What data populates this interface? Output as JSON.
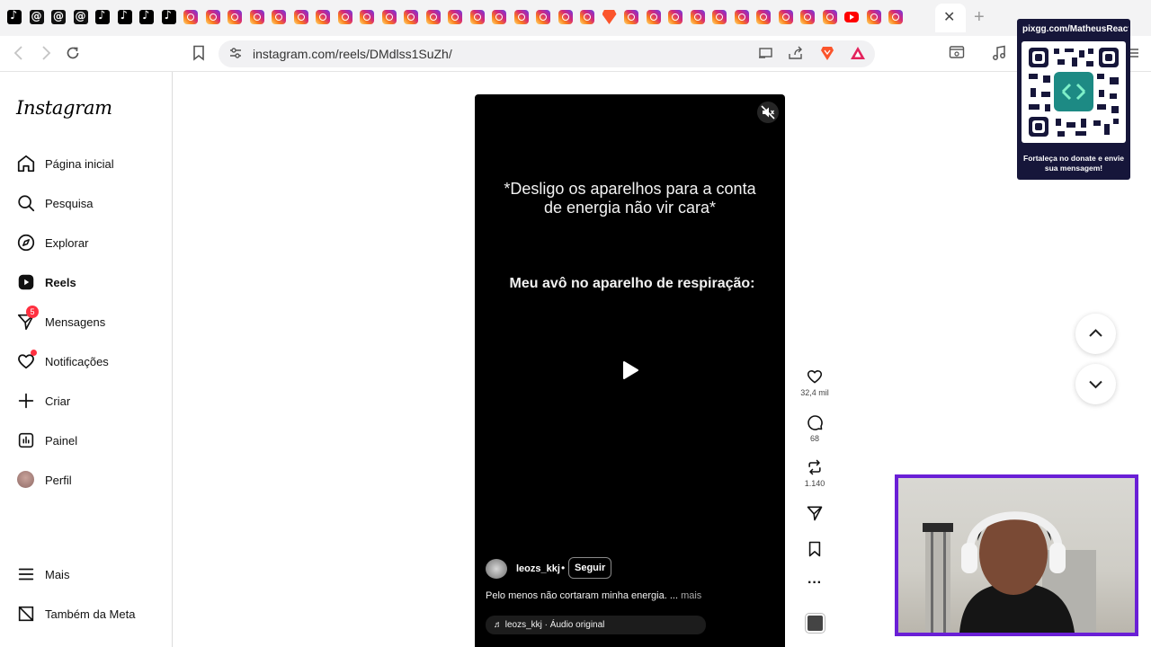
{
  "browser": {
    "tabs": [
      "tiktok",
      "threads",
      "threads",
      "threads",
      "tiktok",
      "tiktok",
      "tiktok",
      "tiktok",
      "insta",
      "insta",
      "insta",
      "insta",
      "insta",
      "insta",
      "insta",
      "insta",
      "insta",
      "insta",
      "insta",
      "insta",
      "insta",
      "insta",
      "insta",
      "insta",
      "insta",
      "insta",
      "insta",
      "brave",
      "insta",
      "insta",
      "insta",
      "insta",
      "insta",
      "insta",
      "insta",
      "insta",
      "insta",
      "insta",
      "youtube",
      "insta",
      "insta"
    ],
    "url": "instagram.com/reels/DMdlss1SuZh/",
    "close_glyph": "✕",
    "new_tab_glyph": "+"
  },
  "sidebar": {
    "logo": "Instagram",
    "items": [
      {
        "label": "Página inicial",
        "icon": "home-icon"
      },
      {
        "label": "Pesquisa",
        "icon": "search-icon"
      },
      {
        "label": "Explorar",
        "icon": "compass-icon"
      },
      {
        "label": "Reels",
        "icon": "reels-icon",
        "active": true
      },
      {
        "label": "Mensagens",
        "icon": "messenger-icon",
        "badge": "5"
      },
      {
        "label": "Notificações",
        "icon": "heart-icon"
      },
      {
        "label": "Criar",
        "icon": "plus-icon"
      },
      {
        "label": "Painel",
        "icon": "dashboard-icon"
      },
      {
        "label": "Perfil",
        "icon": "avatar"
      }
    ],
    "bottom": [
      {
        "label": "Mais",
        "icon": "menu-icon"
      },
      {
        "label": "Também da Meta",
        "icon": "meta-icon"
      }
    ]
  },
  "reel": {
    "caption_top": "*Desligo os aparelhos para a conta de energia não vir cara*",
    "caption_bottom": "Meu avô no aparelho de respiração:",
    "author": "leozs_kkj",
    "separator": "•",
    "follow": "Seguir",
    "description": "Pelo menos não cortaram minha energia. ...",
    "more": "mais",
    "audio": "♬ leozs_kkj · Áudio original"
  },
  "actions": {
    "likes": "32,4 mil",
    "comments": "68",
    "reposts": "1.140",
    "more_glyph": "···"
  },
  "overlay": {
    "qr_title": "pixgg.com/MatheusReact",
    "qr_caption": "Fortaleça no donate e envie sua mensagem!"
  },
  "colors": {
    "badge": "#ff3040",
    "webcam_border": "#6a1fd6",
    "qr_panel": "#16163a"
  }
}
